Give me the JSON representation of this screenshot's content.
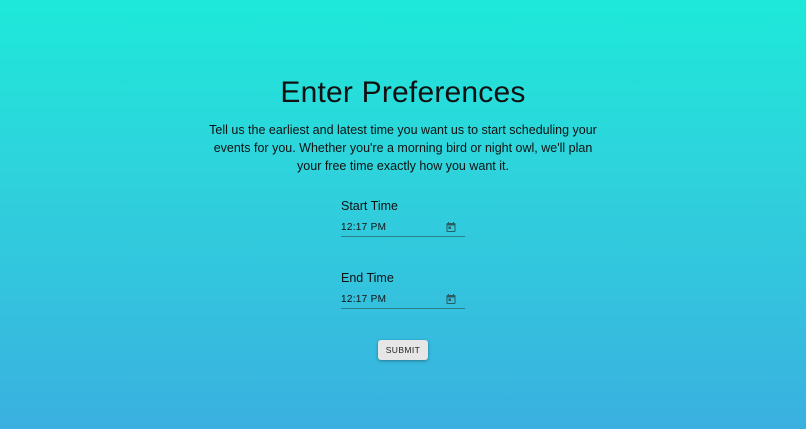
{
  "page": {
    "title": "Enter Preferences",
    "description": "Tell us the earliest and latest time you want us to start scheduling your events for you. Whether you're a morning bird or night owl, we'll plan your free time exactly how you want it."
  },
  "form": {
    "start": {
      "label": "Start Time",
      "value": "12:17 PM",
      "icon": "calendar-icon"
    },
    "end": {
      "label": "End Time",
      "value": "12:17 PM",
      "icon": "calendar-icon"
    },
    "submit_label": "SUBMIT"
  },
  "colors": {
    "gradient_top": "#1de9d9",
    "gradient_bottom": "#3ab0e0",
    "button_bg": "#e6e6e6"
  }
}
